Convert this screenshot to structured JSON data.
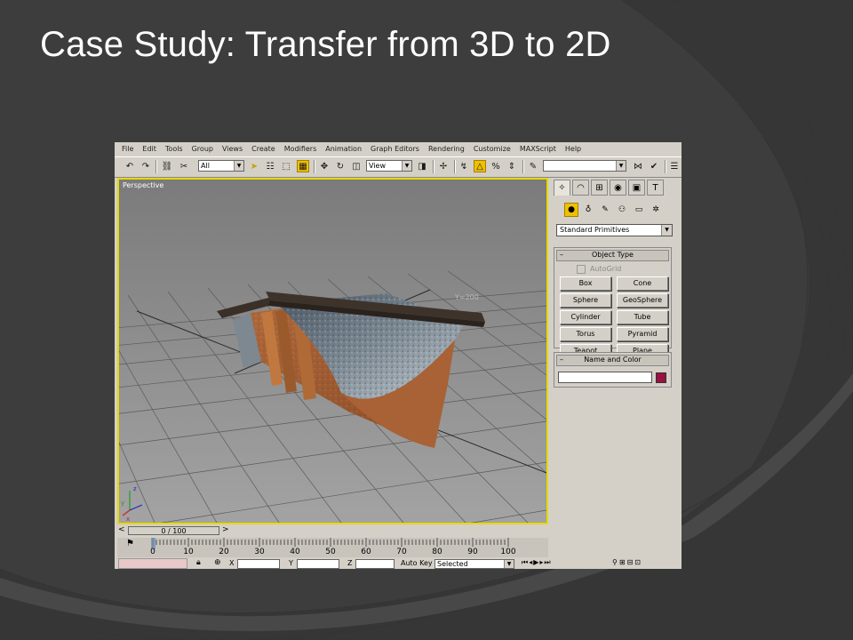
{
  "slide": {
    "title": "Case Study: Transfer from 3D to 2D"
  },
  "colors": {
    "slide_background": "#3d3d3d",
    "viewport_border": "#e8d800",
    "active_button": "#f0c000",
    "object_color": "#9a1040"
  },
  "app": {
    "menu": [
      "File",
      "Edit",
      "Tools",
      "Group",
      "Views",
      "Create",
      "Modifiers",
      "Animation",
      "Graph Editors",
      "Rendering",
      "Customize",
      "MAXScript",
      "Help"
    ],
    "toolbar": {
      "selection_filter": "All",
      "reference_coord": "View",
      "named_selection": ""
    },
    "viewport": {
      "label": "Perspective",
      "axis_label": "Y=200"
    },
    "command_panel": {
      "category": "Standard Primitives",
      "object_type_title": "Object Type",
      "autogrid_label": "AutoGrid",
      "primitives": [
        "Box",
        "Cone",
        "Sphere",
        "GeoSphere",
        "Cylinder",
        "Tube",
        "Torus",
        "Pyramid",
        "Teapot",
        "Plane"
      ],
      "name_color_title": "Name and Color",
      "name_value": ""
    },
    "timeline": {
      "slider_label": "0 / 100",
      "ticks": [
        "0",
        "10",
        "20",
        "30",
        "40",
        "50",
        "60",
        "70",
        "80",
        "90",
        "100"
      ]
    },
    "status": {
      "x_label": "X",
      "y_label": "Y",
      "z_label": "Z",
      "autokey_label": "Auto Key",
      "selected_value": "Selected"
    }
  }
}
